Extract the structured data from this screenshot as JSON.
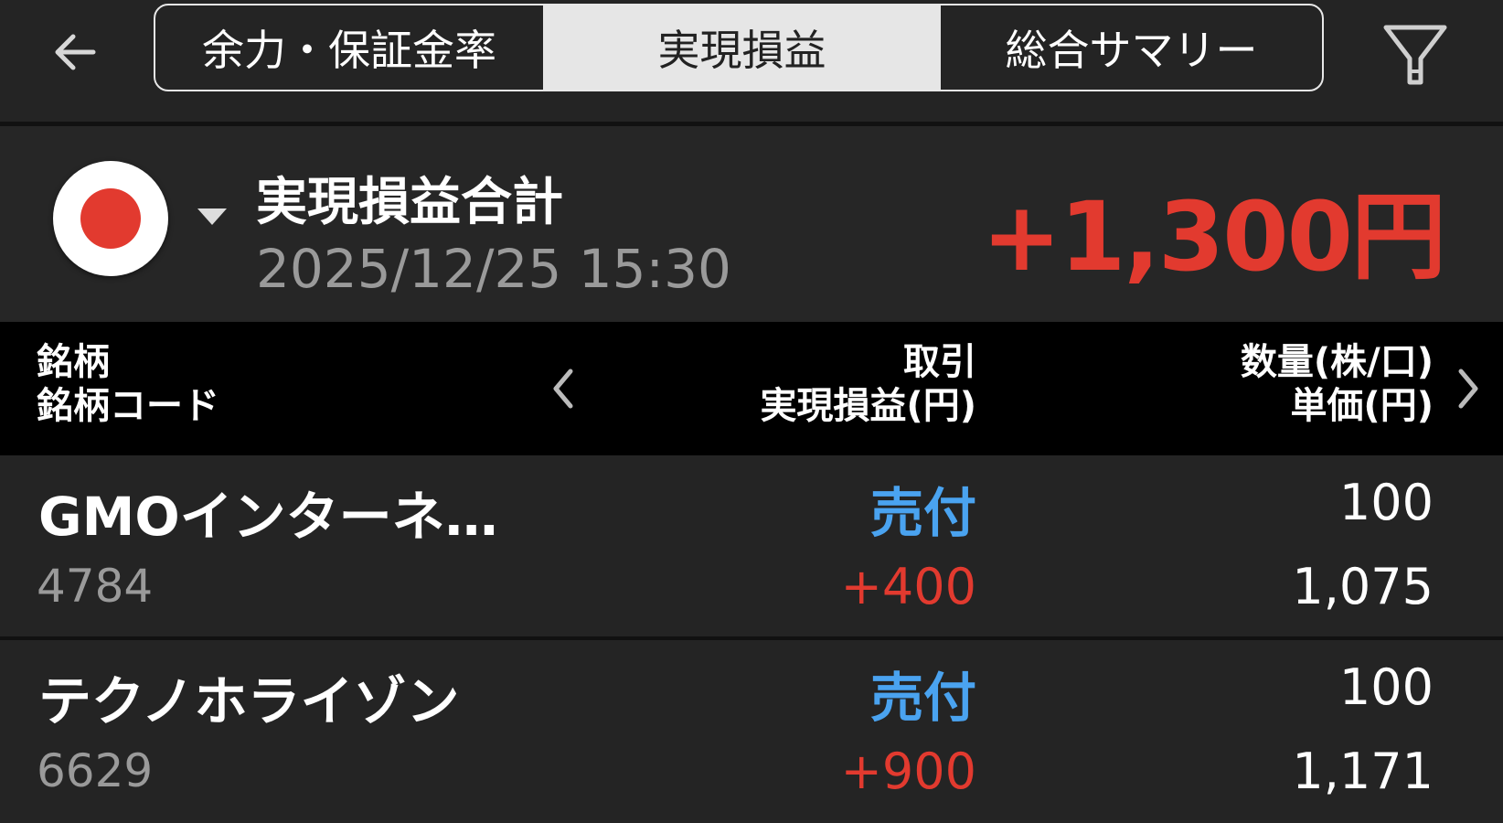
{
  "header": {
    "tabs": [
      "余力・保証金率",
      "実現損益",
      "総合サマリー"
    ],
    "active_tab": "実現損益"
  },
  "summary": {
    "title": "実現損益合計",
    "datetime": "2025/12/25  15:30",
    "total": "+1,300円",
    "total_color": "#e23a2f"
  },
  "table": {
    "col1_line1": "銘柄",
    "col1_line2": "銘柄コード",
    "col2_line1": "取引",
    "col2_line2": "実現損益(円)",
    "col3_line1": "数量(株/口)",
    "col3_line2": "単価(円)",
    "rows": [
      {
        "name": "GMOインターネ…",
        "code": "4784",
        "side": "売付",
        "pnl": "+400",
        "qty": "100",
        "price": "1,075"
      },
      {
        "name": "テクノホライゾン",
        "code": "6629",
        "side": "売付",
        "pnl": "+900",
        "qty": "100",
        "price": "1,171"
      }
    ]
  },
  "colors": {
    "sell": "#4aa3f0",
    "profit": "#e23a2f",
    "background": "#242424"
  },
  "icons": [
    "back-arrow-icon",
    "filter-icon",
    "japan-flag-icon",
    "chevron-left-icon",
    "chevron-right-icon"
  ]
}
